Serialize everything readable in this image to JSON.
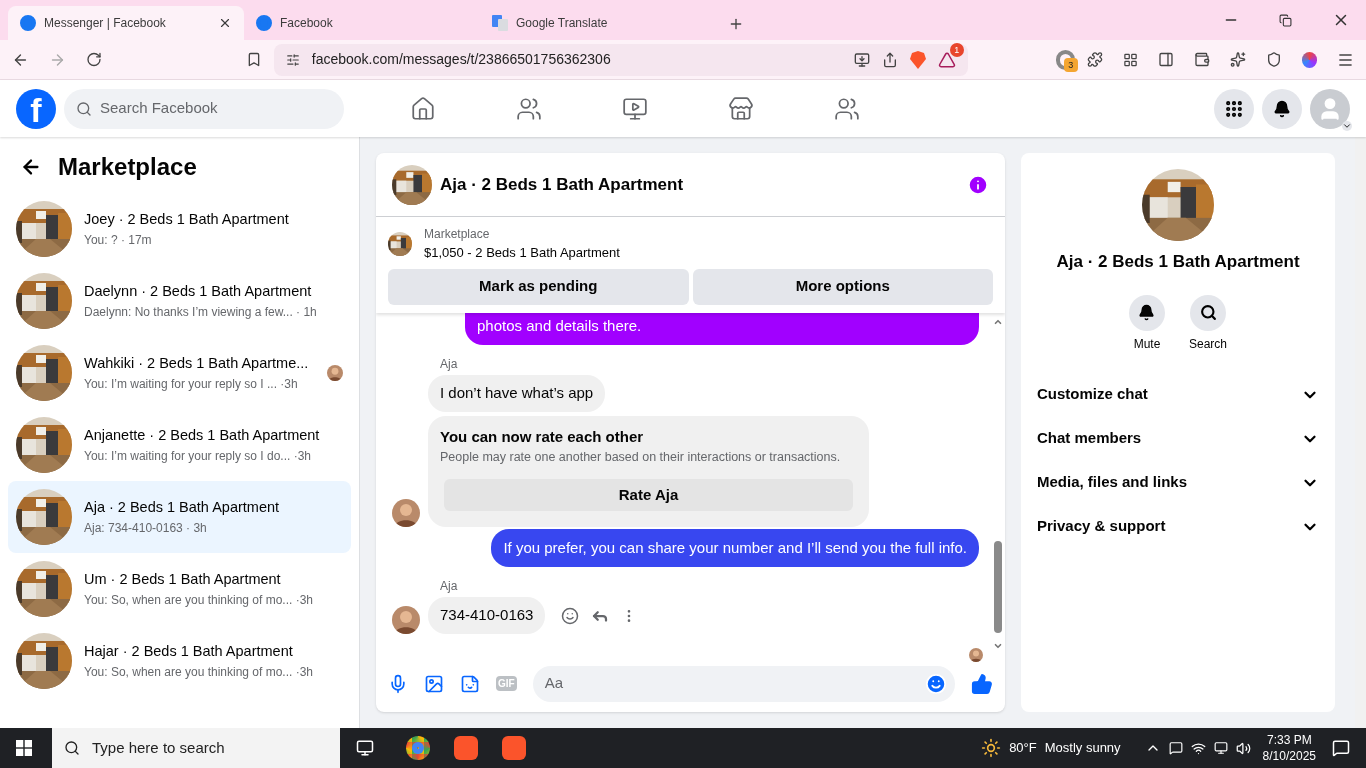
{
  "browser": {
    "tabs": [
      {
        "title": "Messenger | Facebook",
        "selected": true
      },
      {
        "title": "Facebook",
        "selected": false
      },
      {
        "title": "Google Translate",
        "selected": false
      }
    ],
    "url": "facebook.com/messages/t/23866501756362306",
    "brave_badge": "1",
    "extension_badge": "3"
  },
  "facebook": {
    "logo": "f",
    "search": {
      "placeholder": "Search Facebook"
    }
  },
  "sidebar": {
    "title": "Marketplace",
    "conversations": [
      {
        "name": "Joey · 2 Beds 1 Bath Apartment",
        "preview": "You: ? · 17m",
        "selected": false,
        "seen": false
      },
      {
        "name": "Daelynn · 2 Beds 1 Bath Apartment",
        "preview": "Daelynn: No thanks I’m viewing a few... · 1h",
        "selected": false,
        "seen": false
      },
      {
        "name": "Wahkiki · 2 Beds 1 Bath Apartme...",
        "preview": "You: I’m waiting for your reply so I ... ·3h",
        "selected": false,
        "seen": true
      },
      {
        "name": "Anjanette · 2 Beds 1 Bath Apartment",
        "preview": "You: I’m waiting for your reply so I do... ·3h",
        "selected": false,
        "seen": false
      },
      {
        "name": "Aja · 2 Beds 1 Bath Apartment",
        "preview": "Aja: 734-410-0163 · 3h",
        "selected": true,
        "seen": false
      },
      {
        "name": "Um · 2 Beds 1 Bath Apartment",
        "preview": "You: So, when are you thinking of mo... ·3h",
        "selected": false,
        "seen": false
      },
      {
        "name": "Hajar · 2 Beds 1 Bath Apartment",
        "preview": "You: So, when are you thinking of mo... ·3h",
        "selected": false,
        "seen": false
      }
    ]
  },
  "chat": {
    "title": "Aja · 2 Beds 1 Bath Apartment",
    "listing": {
      "label": "Marketplace",
      "title": "$1,050 - 2 Beds 1 Bath Apartment",
      "buttons": [
        "Mark as pending",
        "More options"
      ]
    },
    "messages": [
      {
        "kind": "outgoing",
        "text": "photos and details there.",
        "color": "#a100ff"
      },
      {
        "kind": "sender",
        "text": "Aja"
      },
      {
        "kind": "incoming",
        "text": "I don’t have what’s app",
        "avatar": false,
        "actions": false
      },
      {
        "kind": "rating",
        "title": "You can now rate each other",
        "text": "People may rate one another based on their interactions or transactions.",
        "button": "Rate Aja",
        "avatar": true
      },
      {
        "kind": "outgoing",
        "text": "If you prefer, you can share your number and I’ll send you the full info.",
        "color": "#3847f0"
      },
      {
        "kind": "sender",
        "text": "Aja"
      },
      {
        "kind": "incoming",
        "text": "734-410-0163",
        "avatar": true,
        "actions": true
      }
    ],
    "seen": true,
    "composer": {
      "placeholder": "Aa",
      "gif_label": "GIF"
    }
  },
  "details": {
    "title": "Aja · 2 Beds 1 Bath Apartment",
    "actions": [
      {
        "label": "Mute"
      },
      {
        "label": "Search"
      }
    ],
    "sections": [
      {
        "label": "Customize chat",
        "expanded": false
      },
      {
        "label": "Chat members",
        "expanded": false
      },
      {
        "label": "Media, files and links",
        "expanded": false
      },
      {
        "label": "Privacy & support",
        "expanded": false
      }
    ]
  },
  "taskbar": {
    "search": {
      "placeholder": "Type here to search"
    },
    "temperature": "80°F",
    "weather": "Mostly sunny",
    "time": "7:33 PM",
    "date": "8/10/2025"
  }
}
